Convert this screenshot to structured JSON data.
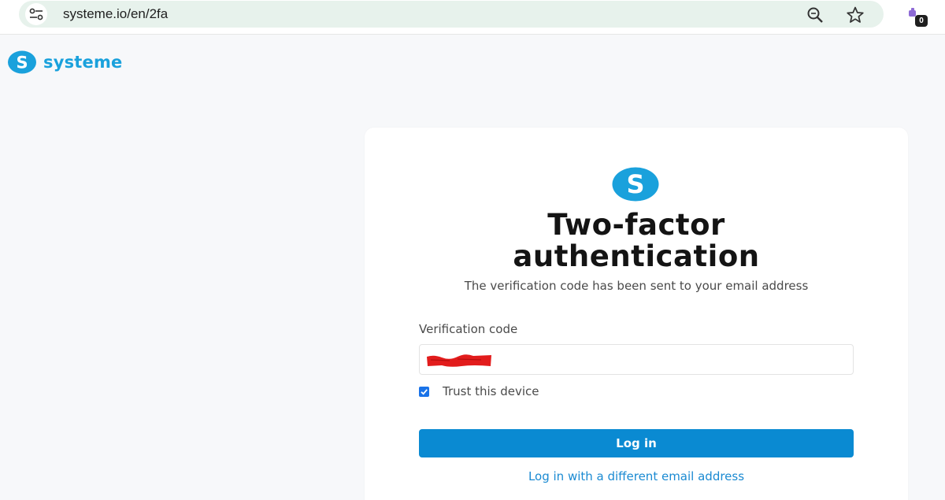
{
  "browser": {
    "url": "systeme.io/en/2fa",
    "site_info_icon": "tune-icon",
    "zoom_icon": "zoom-icon",
    "bookmark_icon": "star-icon",
    "extension_badge": "0"
  },
  "brand": {
    "name": "systeme",
    "color": "#1aa1dc"
  },
  "card": {
    "title_line1": "Two-factor",
    "title_line2": "authentication",
    "subtitle": "The verification code has been sent to your email address",
    "field_label": "Verification code",
    "trust_label": "Trust this device",
    "trust_checked": true,
    "login_label": "Log in",
    "alt_link": "Log in with a different email address"
  },
  "colors": {
    "accent": "#0a8ad2",
    "link": "#1a8ad2",
    "page_bg": "#f7f8fa",
    "redaction": "#e21c1c"
  }
}
